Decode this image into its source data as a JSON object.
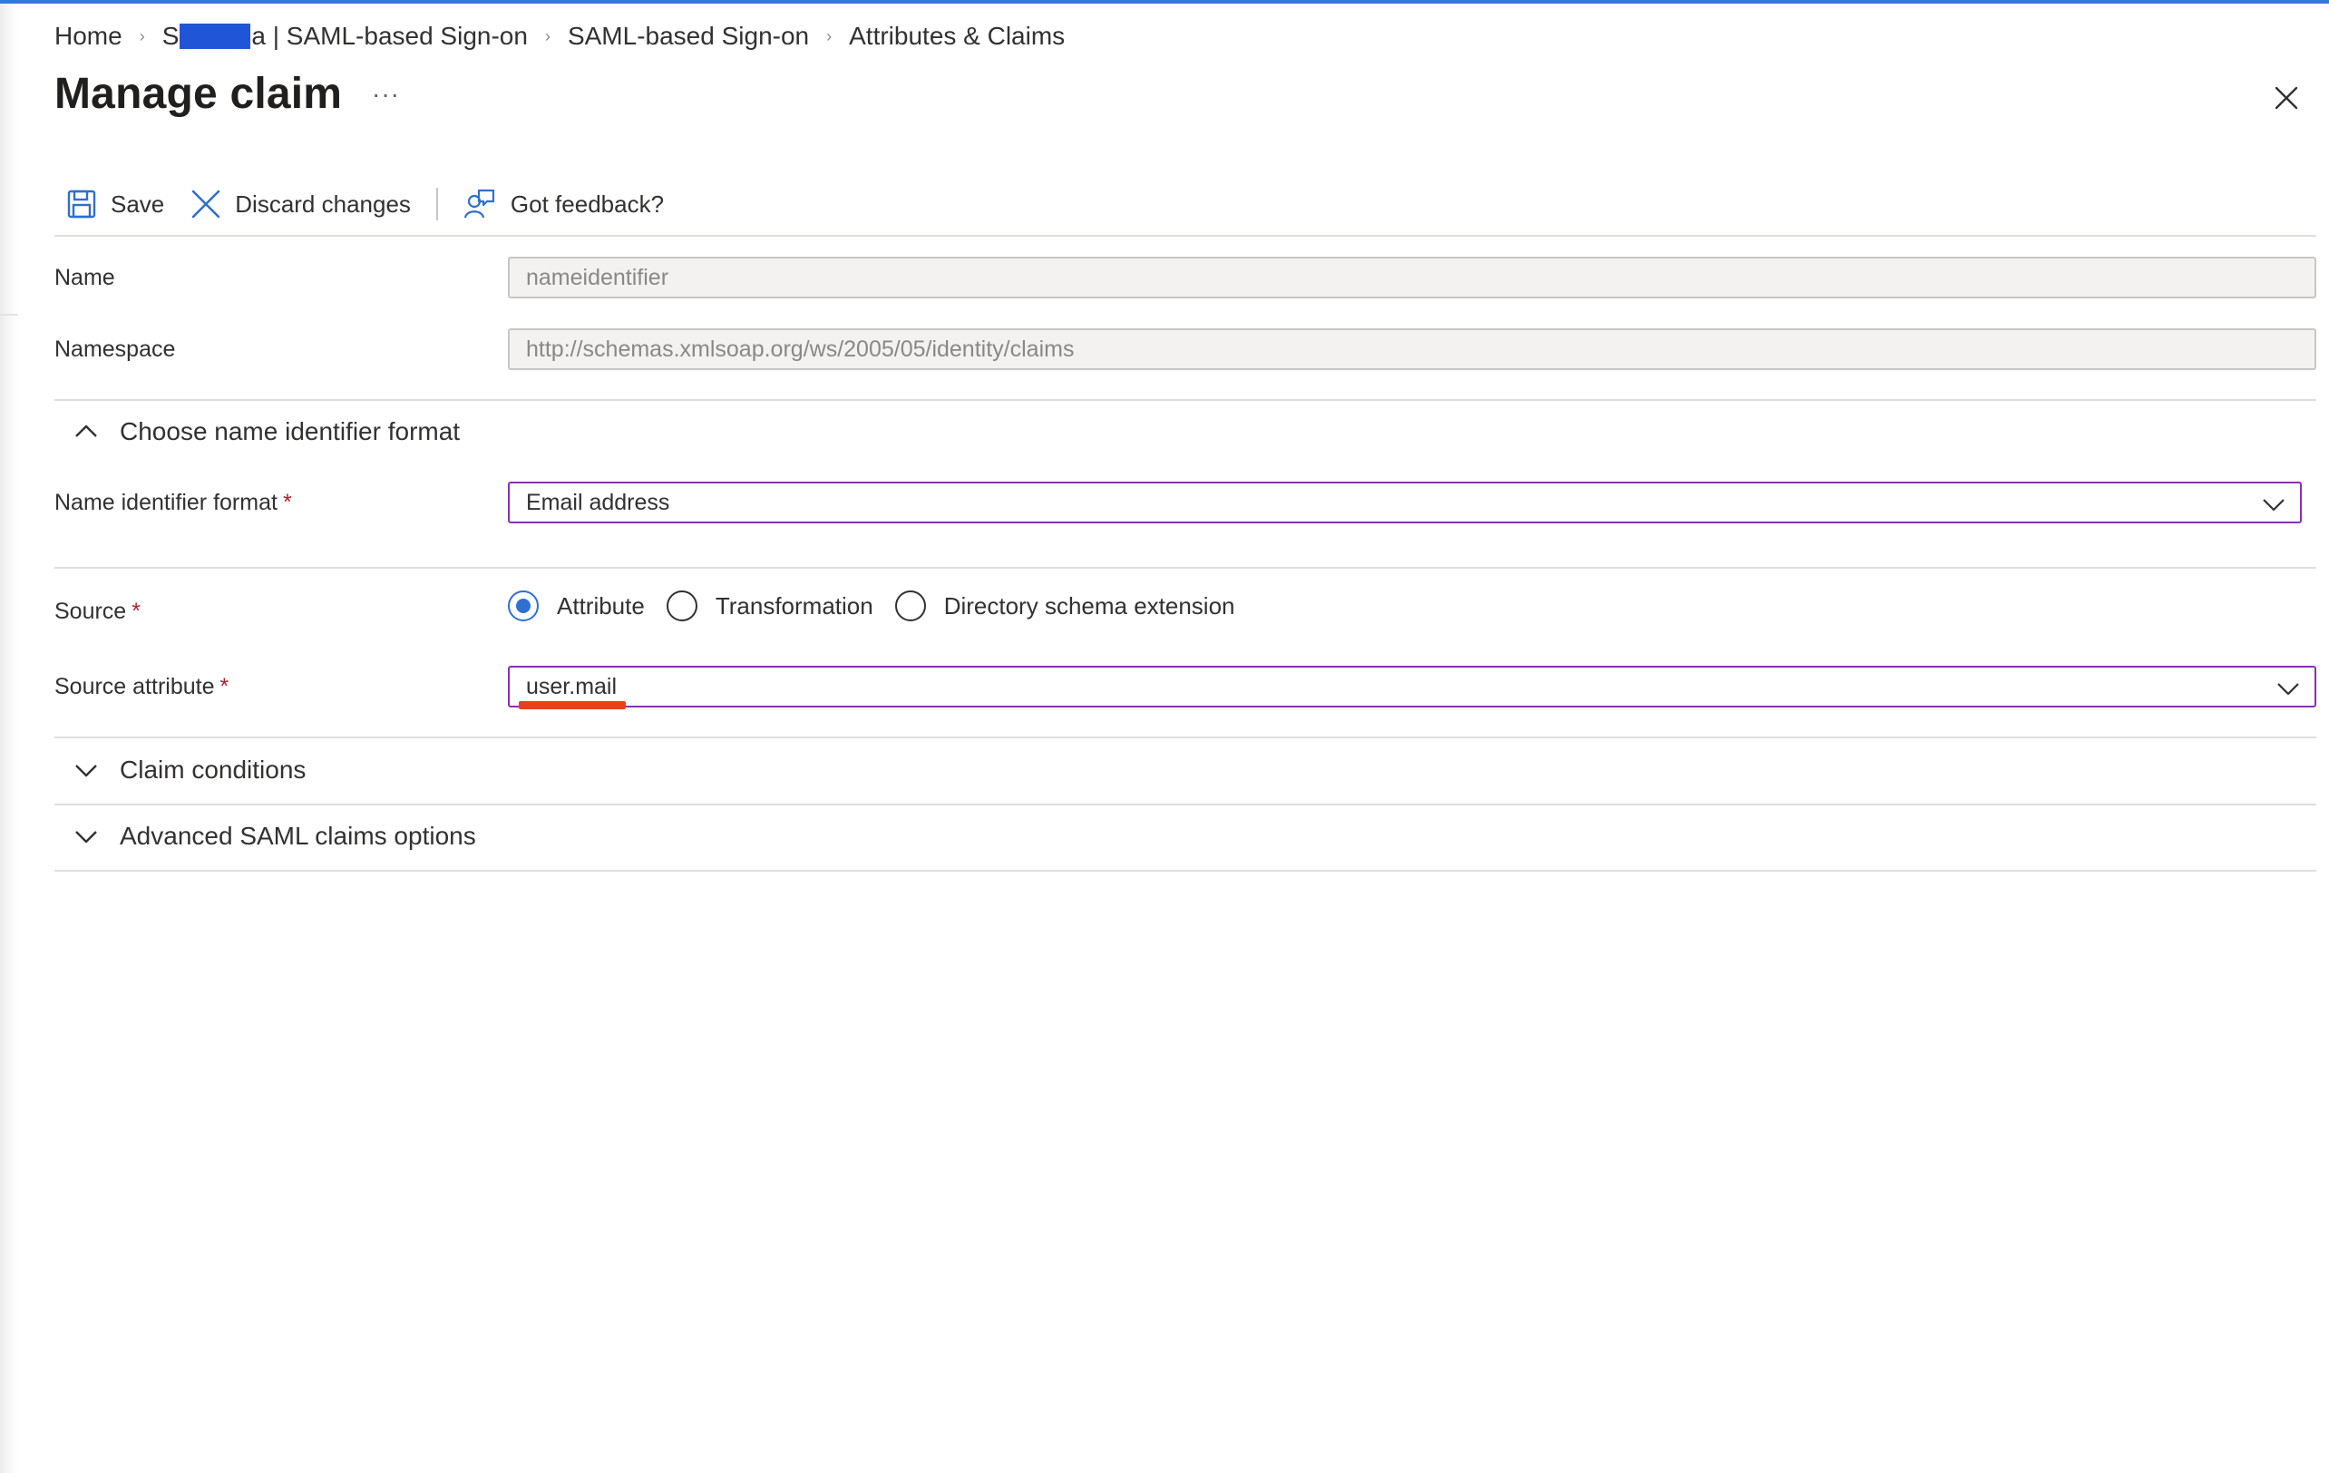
{
  "breadcrumb": {
    "home": "Home",
    "app_prefix": "S",
    "app_suffix": "a | SAML-based Sign-on",
    "saml": "SAML-based Sign-on",
    "attributes": "Attributes & Claims"
  },
  "page": {
    "title": "Manage claim",
    "more_label": "···"
  },
  "toolbar": {
    "save_label": "Save",
    "discard_label": "Discard changes",
    "feedback_label": "Got feedback?"
  },
  "form": {
    "name_label": "Name",
    "name_value": "nameidentifier",
    "namespace_label": "Namespace",
    "namespace_value": "http://schemas.xmlsoap.org/ws/2005/05/identity/claims",
    "nameid_section_label": "Choose name identifier format",
    "nameid_format_label": "Name identifier format",
    "nameid_format_value": "Email address",
    "source_label": "Source",
    "source_options": [
      "Attribute",
      "Transformation",
      "Directory schema extension"
    ],
    "source_selected": "Attribute",
    "source_attribute_label": "Source attribute",
    "source_attribute_value": "user.mail",
    "required_marker": "*",
    "claim_conditions_label": "Claim conditions",
    "advanced_label": "Advanced SAML claims options"
  },
  "colors": {
    "accent_blue": "#2f6fd0",
    "focus_border": "#8a2fb6",
    "required_red": "#a4262c",
    "annotation_red": "#e84118"
  },
  "icons": [
    "save-icon",
    "discard-icon",
    "feedback-icon",
    "close-icon",
    "chevron-up-icon",
    "chevron-down-icon"
  ]
}
